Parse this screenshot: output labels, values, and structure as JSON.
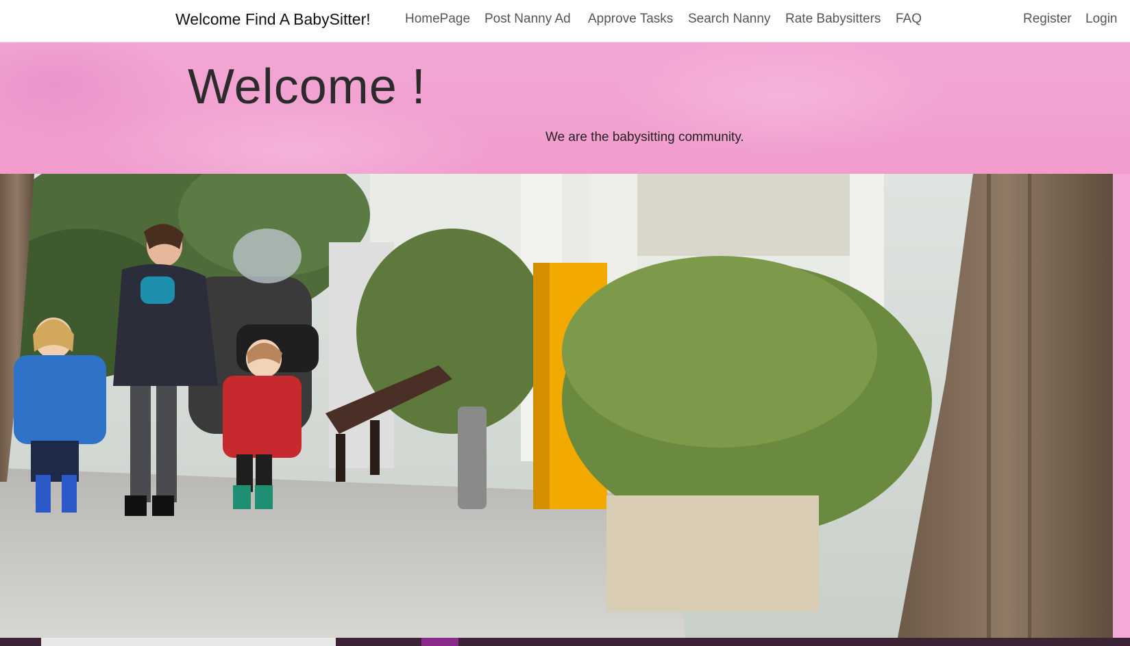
{
  "navbar": {
    "brand": "Welcome Find A BabySitter!",
    "links": [
      "HomePage",
      "Post Nanny Ad",
      "Approve Tasks",
      "Search Nanny",
      "Rate Babysitters",
      "FAQ"
    ],
    "account_links": [
      "Register",
      "Login"
    ]
  },
  "hero": {
    "title": "Welcome !",
    "subtitle": "We are the babysitting community."
  },
  "photo": {
    "icon": "family-walking-photo"
  },
  "colors": {
    "hero_pink": "#f3a7d4",
    "navbar_bg": "#ffffff",
    "nav_text": "#555555"
  }
}
